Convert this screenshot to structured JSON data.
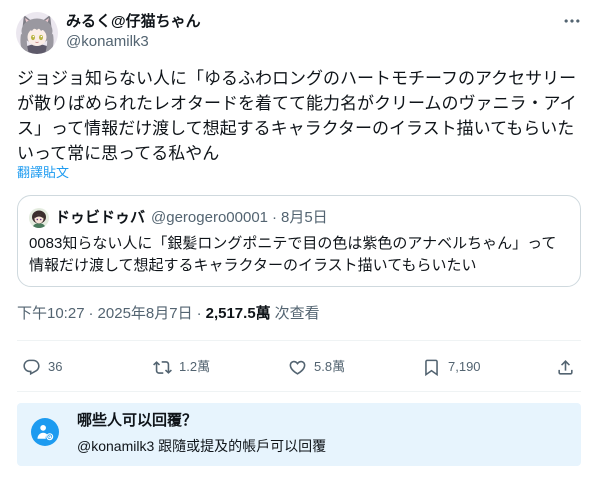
{
  "colors": {
    "text": "#0f1419",
    "muted": "#536471",
    "accent": "#1d9bf0",
    "border": "#cfd9de",
    "divider": "#eff3f4",
    "card_bg": "#e7f4fd"
  },
  "post": {
    "author": {
      "display_name": "みるく@仔猫ちゃん",
      "handle": "@konamilk3"
    },
    "more_icon": "more-horizontal-icon",
    "text_lines": [
      "ジョジョ知らない人に「ゆるふわロングのハートモチーフのアクセサリー",
      "が散りばめられたレオタードを着てて能力名がクリームのヴァニラ・アイ",
      "ス」って情報だけ渡して想起するキャラクターのイラスト描いてもらいた",
      "いって常に思ってる私やん"
    ],
    "translate_label": "翻譯貼文",
    "quoted_post": {
      "author": {
        "display_name": "ドゥビドゥバ",
        "handle": "@gerogero00001"
      },
      "separator": "·",
      "date": "8月5日",
      "text_lines": [
        "0083知らない人に「銀髪ロングポニテで目の色は紫色のアナベルちゃん」って",
        "情報だけ渡して想起するキャラクターのイラスト描いてもらいたい"
      ]
    },
    "meta": {
      "time": "下午10:27",
      "separator": "·",
      "date": "2025年8月7日",
      "views_count": "2,517.5萬",
      "views_label": "次查看"
    },
    "actions": {
      "reply": {
        "icon": "reply-icon",
        "count": "36"
      },
      "repost": {
        "icon": "repost-icon",
        "count": "1.2萬"
      },
      "like": {
        "icon": "heart-icon",
        "count": "5.8萬"
      },
      "bookmark": {
        "icon": "bookmark-icon",
        "count": "7,190"
      },
      "share": {
        "icon": "share-icon"
      }
    }
  },
  "reply_restriction": {
    "icon": "person-at-icon",
    "title": "哪些人可以回覆？",
    "description": "@konamilk3 跟隨或提及的帳戶可以回覆"
  }
}
